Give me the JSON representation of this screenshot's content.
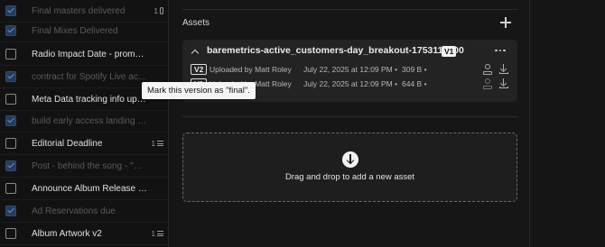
{
  "tasks": [
    {
      "title": "Final masters delivered",
      "done": true,
      "meta": "1"
    },
    {
      "title": "Final Mixes Delivered",
      "done": true,
      "meta": ""
    },
    {
      "title": "Radio Impact Date - promo team ...",
      "done": false,
      "meta": ""
    },
    {
      "title": "contract for Spotify Live activ...",
      "done": true,
      "meta": ""
    },
    {
      "title": "Meta Data tracking info update",
      "done": false,
      "meta": ""
    },
    {
      "title": "build early access landing page f...",
      "done": true,
      "meta": ""
    },
    {
      "title": "Editorial Deadline",
      "done": false,
      "meta": "1"
    },
    {
      "title": "Post - behind the song - \"all social...",
      "done": true,
      "meta": ""
    },
    {
      "title": "Announce Album Release Date",
      "done": false,
      "meta": ""
    },
    {
      "title": "Ad Reservations due",
      "done": true,
      "meta": ""
    },
    {
      "title": "Album Artwork v2",
      "done": false,
      "meta": "1"
    }
  ],
  "assets": {
    "title": "Assets",
    "asset_name": "baremetrics-active_customers-day_breakout-1753118600",
    "current_version": "V1",
    "versions": [
      {
        "label": "V2",
        "uploader": "Uploaded by Matt Roley",
        "date": "July 22, 2025 at 12:09 PM",
        "size": "309 B"
      },
      {
        "label": "V1",
        "uploader": "Uploaded by Matt Roley",
        "date": "July 22, 2025 at 12:09 PM",
        "size": "644 B"
      }
    ]
  },
  "dropzone": {
    "text": "Drag and drop to add a new asset"
  },
  "tooltip": {
    "text": "Mark this version as \"final\"."
  }
}
